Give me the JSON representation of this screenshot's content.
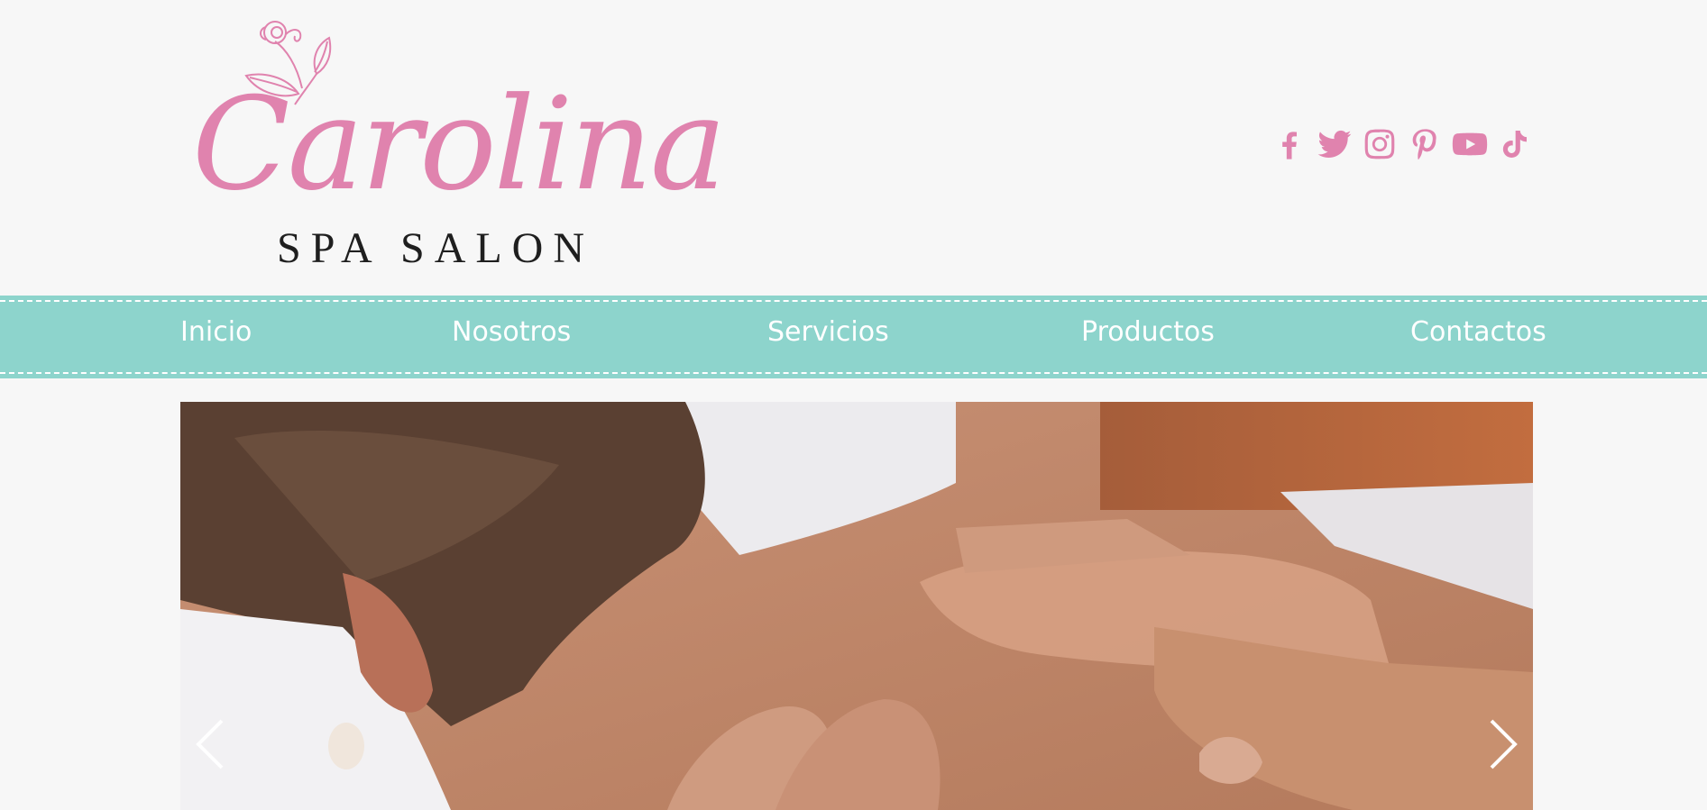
{
  "brand": {
    "logo_script": "Carolina",
    "logo_subtitle": "SPA SALON",
    "primary_color": "#e083ae"
  },
  "social": [
    {
      "name": "facebook-icon"
    },
    {
      "name": "twitter-icon"
    },
    {
      "name": "instagram-icon"
    },
    {
      "name": "pinterest-icon"
    },
    {
      "name": "youtube-icon"
    },
    {
      "name": "tiktok-icon"
    }
  ],
  "nav": {
    "background": "#8dd4cc",
    "items": [
      {
        "label": "Inicio"
      },
      {
        "label": "Nosotros"
      },
      {
        "label": "Servicios"
      },
      {
        "label": "Productos"
      },
      {
        "label": "Contactos"
      }
    ]
  },
  "slider": {
    "prev_icon": "chevron-left-icon",
    "next_icon": "chevron-right-icon"
  }
}
